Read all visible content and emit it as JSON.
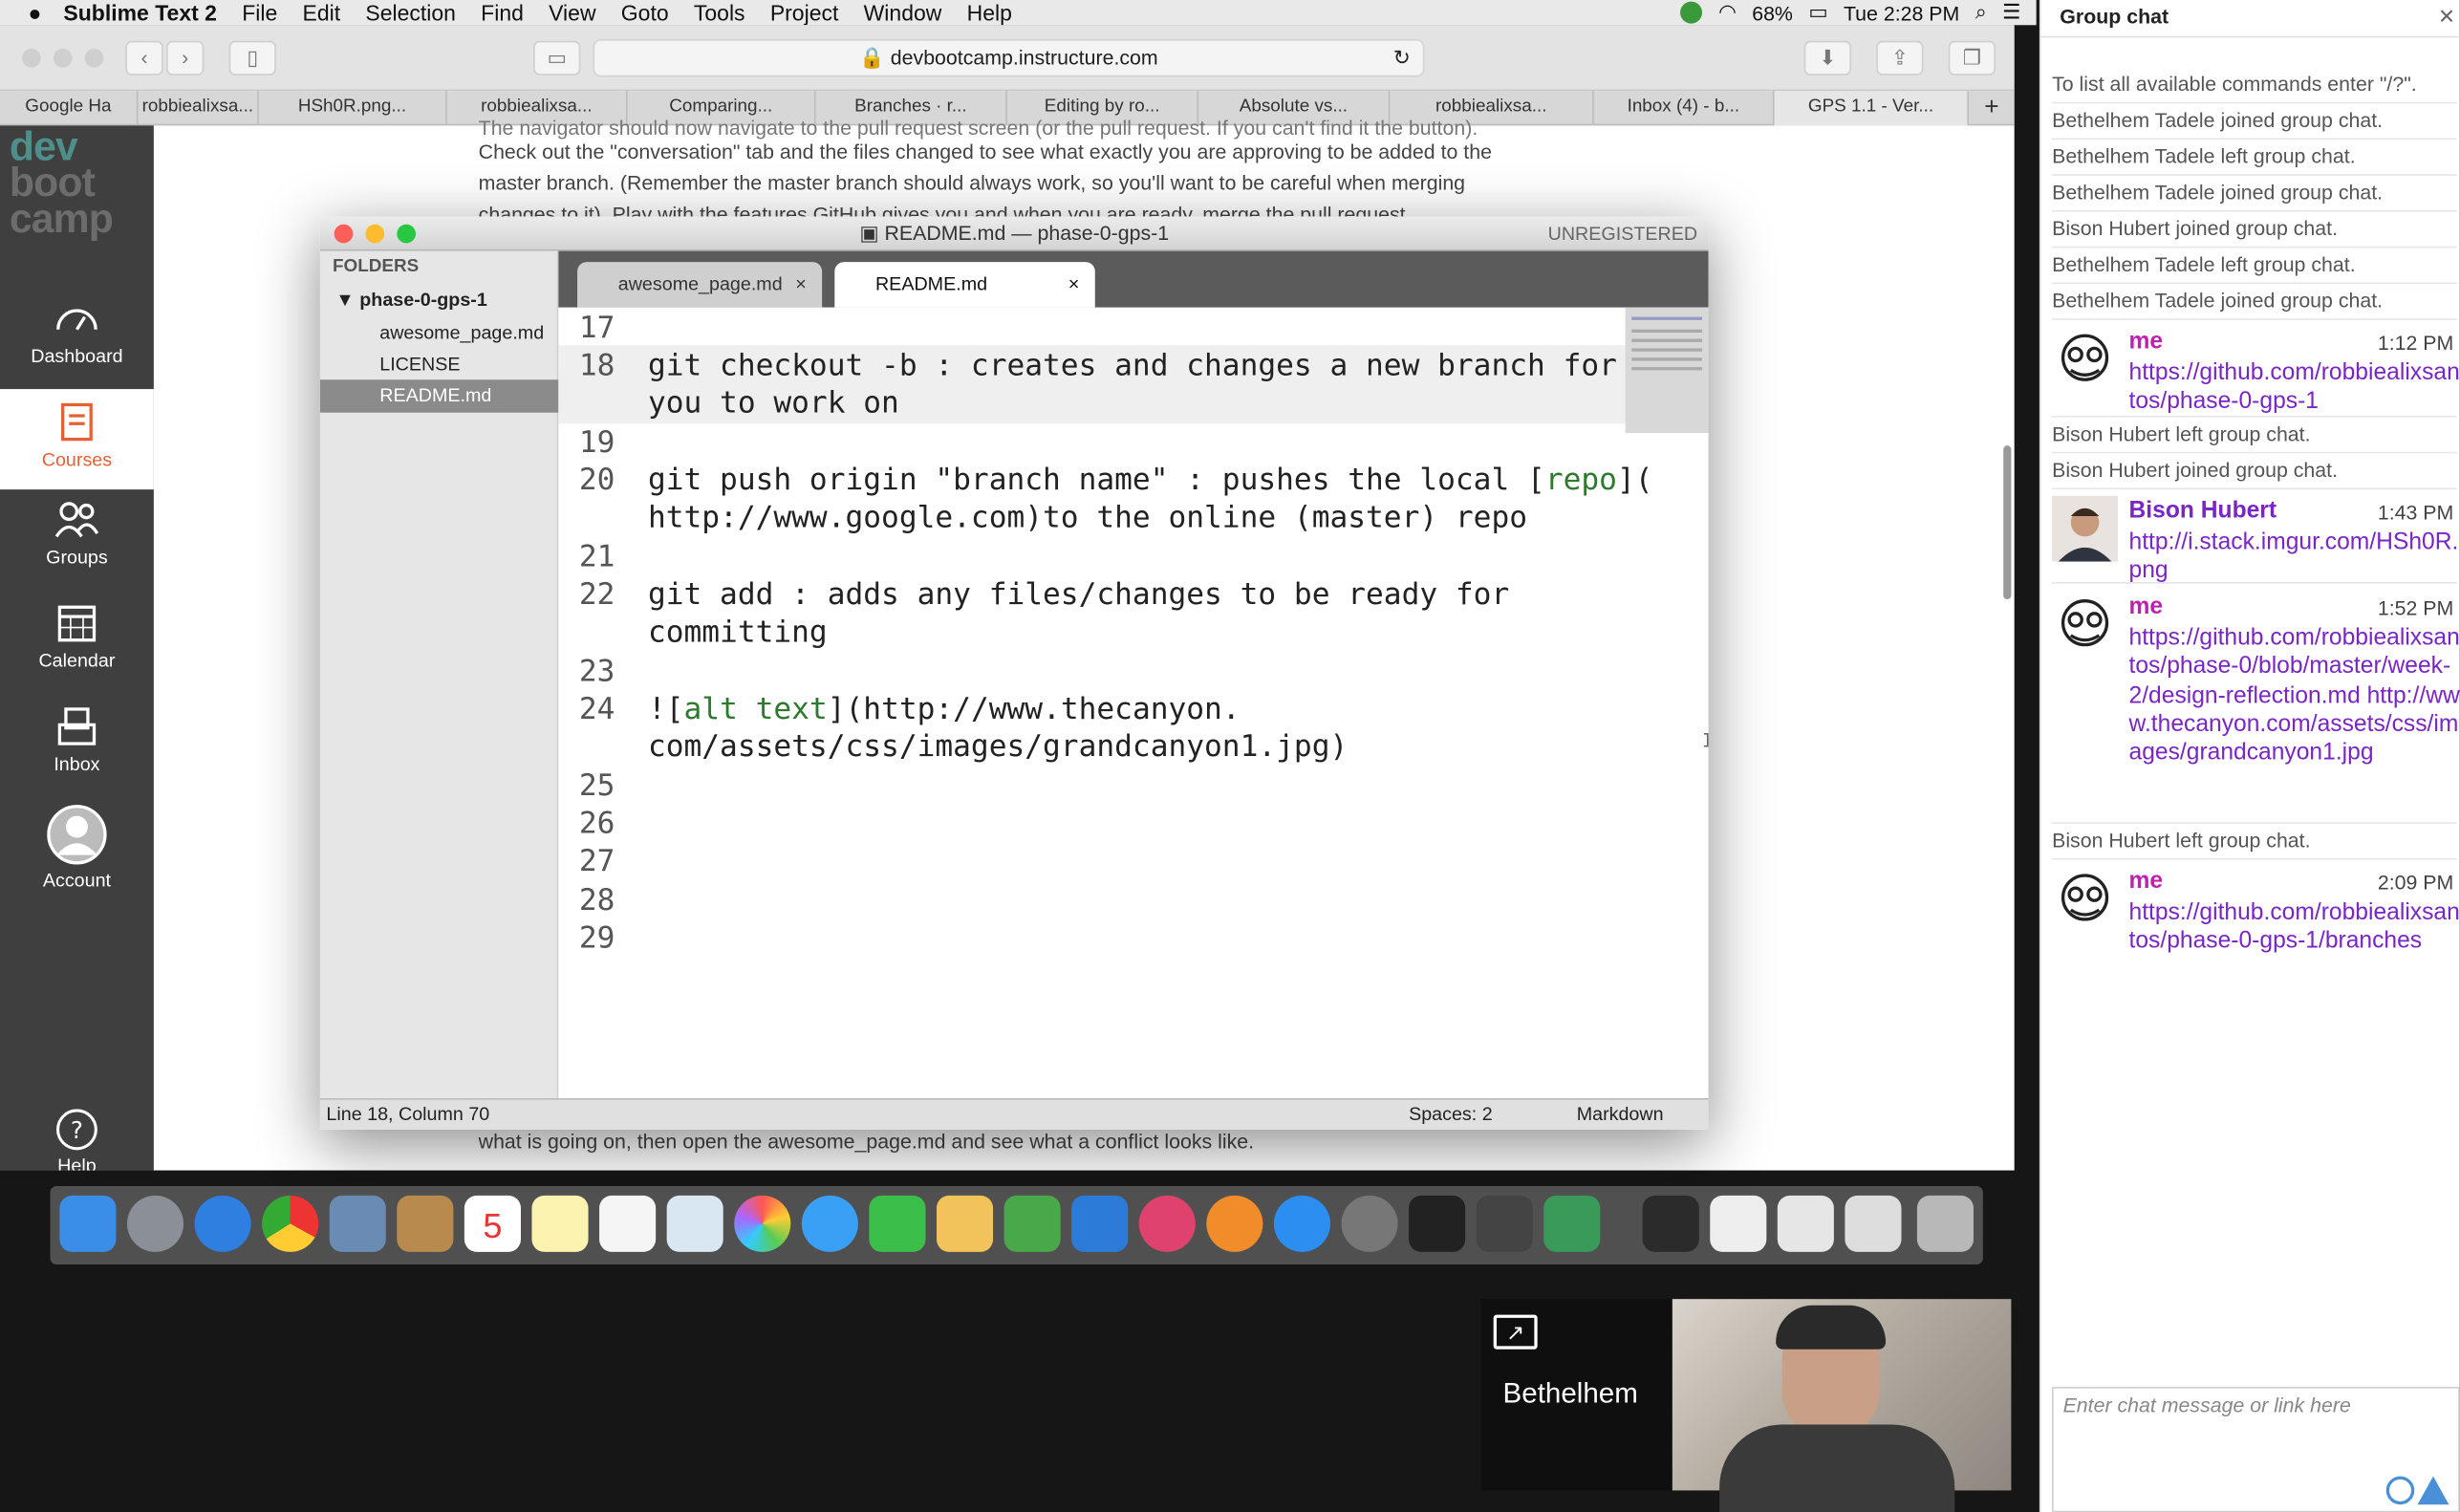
{
  "menubar": {
    "app": "Sublime Text 2",
    "items": [
      "File",
      "Edit",
      "Selection",
      "Find",
      "View",
      "Goto",
      "Tools",
      "Project",
      "Window",
      "Help"
    ],
    "battery": "68%",
    "clock": "Tue 2:28 PM"
  },
  "browser": {
    "url": "devbootcamp.instructure.com",
    "tabs": [
      "Google Ha",
      "robbiealixsa...",
      "HSh0R.png...",
      "robbiealixsa...",
      "Comparing...",
      "Branches · r...",
      "Editing by ro...",
      "Absolute vs...",
      "robbiealixsa...",
      "Inbox (4) - b...",
      "GPS 1.1 - Ver..."
    ],
    "new_tab": "+"
  },
  "canvas": {
    "logo": [
      "dev",
      "boot",
      "camp"
    ],
    "nav": [
      {
        "label": "Dashboard",
        "icon": "dashboard-icon"
      },
      {
        "label": "Courses",
        "icon": "courses-icon"
      },
      {
        "label": "Groups",
        "icon": "groups-icon"
      },
      {
        "label": "Calendar",
        "icon": "calendar-icon"
      },
      {
        "label": "Inbox",
        "icon": "inbox-icon"
      },
      {
        "label": "Account",
        "icon": "account-icon"
      },
      {
        "label": "Help",
        "icon": "help-icon"
      }
    ],
    "page_lines": [
      "The navigator should now navigate to the pull request screen (or the pull request. If you can't find it the button).",
      "Check out the \"conversation\" tab and the files changed to see what exactly you are approving to be added to the",
      "master branch. (Remember the master branch should always work, so you'll want to be careful when merging",
      "changes to it). Play with the features GitHub gives you and when you are ready, merge the pull request."
    ],
    "page_bottom": "what is going on, then open the awesome_page.md and see what a conflict looks like."
  },
  "sublime": {
    "title": "README.md — phase-0-gps-1",
    "unregistered": "UNREGISTERED",
    "folders_header": "FOLDERS",
    "root_folder": "phase-0-gps-1",
    "files": [
      "awesome_page.md",
      "LICENSE",
      "README.md"
    ],
    "tabs": [
      {
        "label": "awesome_page.md",
        "close": "×"
      },
      {
        "label": "README.md",
        "close": "×"
      }
    ],
    "lines": [
      {
        "n": "17",
        "rows": [
          ""
        ]
      },
      {
        "n": "18",
        "rows": [
          "git checkout -b : creates and changes a new branch for",
          "you to work on"
        ]
      },
      {
        "n": "19",
        "rows": [
          ""
        ]
      },
      {
        "n": "20",
        "rows": [
          "git push origin \"branch name\" : pushes the local [repo](",
          "http://www.google.com)to the online (master) repo"
        ]
      },
      {
        "n": "21",
        "rows": [
          ""
        ]
      },
      {
        "n": "22",
        "rows": [
          "git add : adds any files/changes to be ready for",
          "committing"
        ]
      },
      {
        "n": "23",
        "rows": [
          ""
        ]
      },
      {
        "n": "24",
        "rows": [
          "![alt text](http://www.thecanyon.",
          "com/assets/css/images/grandcanyon1.jpg)"
        ]
      },
      {
        "n": "25",
        "rows": [
          ""
        ]
      },
      {
        "n": "26",
        "rows": [
          ""
        ]
      },
      {
        "n": "27",
        "rows": [
          ""
        ]
      },
      {
        "n": "28",
        "rows": [
          ""
        ]
      },
      {
        "n": "29",
        "rows": [
          ""
        ]
      }
    ],
    "status_left": "Line 18, Column 70",
    "status_spaces": "Spaces: 2",
    "status_syntax": "Markdown"
  },
  "video": {
    "participant": "Bethelhem"
  },
  "chat": {
    "header": "Group chat",
    "close": "✕",
    "system_top": [
      "To list all available commands enter \"/?\".",
      "Bethelhem Tadele joined group chat.",
      "Bethelhem Tadele left group chat.",
      "Bethelhem Tadele joined group chat.",
      "Bison Hubert joined group chat.",
      "Bethelhem Tadele left group chat.",
      "Bethelhem Tadele joined group chat."
    ],
    "messages": [
      {
        "who": "me",
        "time": "1:12 PM",
        "text": "https://github.com/robbiealixsantos/phase-0-gps-1"
      },
      {
        "who": "Bison Hubert",
        "time": "1:43 PM",
        "text": "http://i.stack.imgur.com/HSh0R.png"
      },
      {
        "who": "me",
        "time": "1:52 PM",
        "text": "https://github.com/robbiealixsantos/phase-0/blob/master/week-2/design-reflection.md http://www.thecanyon.com/assets/css/images/grandcanyon1.jpg"
      },
      {
        "who": "me",
        "time": "2:09 PM",
        "text": "https://github.com/robbiealixsantos/phase-0-gps-1/branches"
      }
    ],
    "system_mid": [
      "Bison Hubert left group chat.",
      "Bison Hubert joined group chat."
    ],
    "system_late": "Bison Hubert left group chat.",
    "input_placeholder": "Enter chat message or link here"
  }
}
